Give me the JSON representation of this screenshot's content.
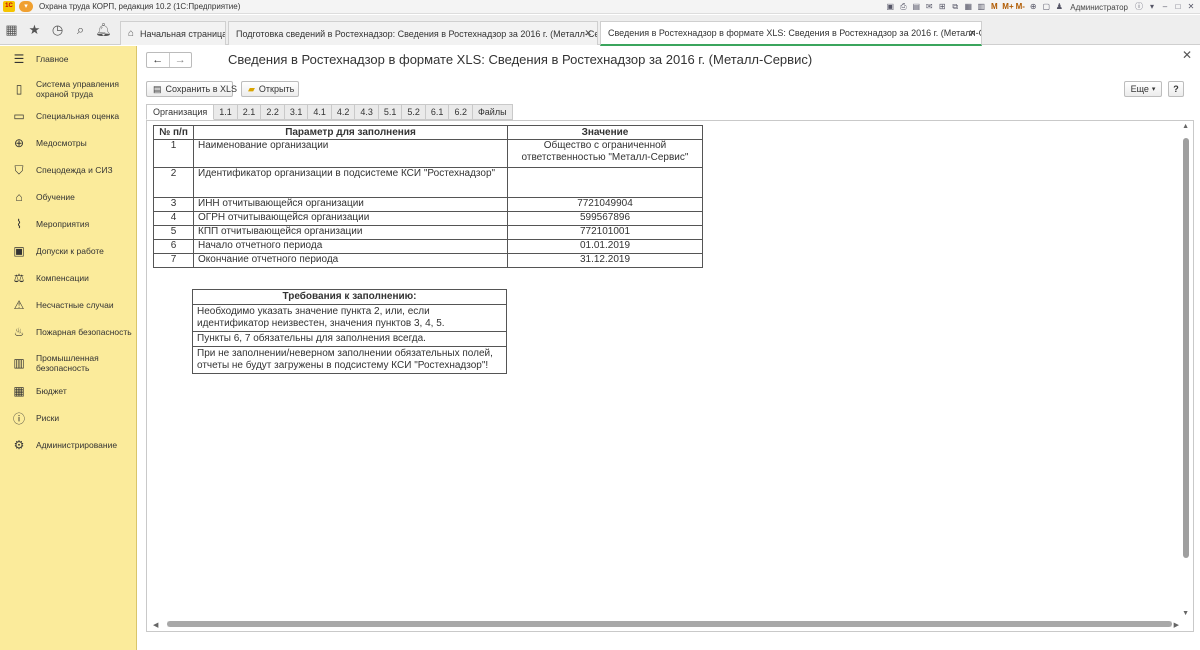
{
  "window": {
    "title": "Охрана труда КОРП, редакция 10.2  (1С:Предприятие)",
    "user": "Администратор",
    "toolbar_letters": [
      "M",
      "M+",
      "M-"
    ]
  },
  "tabs": [
    {
      "label": "Начальная страница"
    },
    {
      "label": "Подготовка сведений в Ростехнадзор: Сведения в Ростехнадзор за 2016 г. (Металл-Сервис)"
    },
    {
      "label": "Сведения в Ростехнадзор в формате XLS: Сведения в Ростехнадзор за 2016 г. (Металл-Сервис)"
    }
  ],
  "sidebar": {
    "items": [
      {
        "label": "Главное",
        "icon": "menu-lines-icon"
      },
      {
        "label": "Система управления охраной труда",
        "icon": "book-icon"
      },
      {
        "label": "Специальная оценка",
        "icon": "document-icon"
      },
      {
        "label": "Медосмотры",
        "icon": "medical-icon"
      },
      {
        "label": "Спецодежда и СИЗ",
        "icon": "shirt-icon"
      },
      {
        "label": "Обучение",
        "icon": "graduation-icon"
      },
      {
        "label": "Мероприятия",
        "icon": "chart-icon"
      },
      {
        "label": "Допуски к работе",
        "icon": "badge-icon"
      },
      {
        "label": "Компенсации",
        "icon": "scales-icon"
      },
      {
        "label": "Несчастные случаи",
        "icon": "warning-icon"
      },
      {
        "label": "Пожарная безопасность",
        "icon": "extinguisher-icon"
      },
      {
        "label": "Промышленная безопасность",
        "icon": "industry-icon"
      },
      {
        "label": "Бюджет",
        "icon": "calculator-icon"
      },
      {
        "label": "Риски",
        "icon": "risk-icon"
      },
      {
        "label": "Администрирование",
        "icon": "gear-icon"
      }
    ]
  },
  "main": {
    "title": "Сведения в Ростехнадзор в формате XLS: Сведения в Ростехнадзор за 2016 г. (Металл-Сервис)",
    "buttons": {
      "save": "Сохранить в XLS",
      "open": "Открыть",
      "more": "Еще",
      "help": "?"
    },
    "sheet_tabs": [
      "Организация",
      "1.1",
      "2.1",
      "2.2",
      "3.1",
      "4.1",
      "4.2",
      "4.3",
      "5.1",
      "5.2",
      "6.1",
      "6.2",
      "Файлы"
    ],
    "table": {
      "headers": [
        "№ п/п",
        "Параметр для заполнения",
        "Значение"
      ],
      "rows": [
        {
          "num": "1",
          "param": "Наименование организации",
          "value": "Общество с ограниченной ответственностью \"Металл-Сервис\""
        },
        {
          "num": "2",
          "param": "Идентификатор организации в подсистеме КСИ \"Ростехнадзор\"",
          "value": ""
        },
        {
          "num": "3",
          "param": "ИНН отчитывающейся организации",
          "value": "7721049904"
        },
        {
          "num": "4",
          "param": "ОГРН отчитывающейся организации",
          "value": "599567896"
        },
        {
          "num": "5",
          "param": "КПП отчитывающейся организации",
          "value": "772101001"
        },
        {
          "num": "6",
          "param": "Начало отчетного периода",
          "value": "01.01.2019"
        },
        {
          "num": "7",
          "param": "Окончание отчетного периода",
          "value": "31.12.2019"
        }
      ]
    },
    "requirements": {
      "header": "Требования к заполнению:",
      "items": [
        "Необходимо  указать  значение пункта 2, или, если идентификатор неизвестен, значения пунктов 3, 4, 5.",
        "Пункты 6, 7 обязательны для заполнения всегда.",
        "При не заполнении/неверном заполнении обязательных полей, отчеты не будут загружены в подсистему КСИ \"Ростехнадзор\"!"
      ]
    }
  }
}
